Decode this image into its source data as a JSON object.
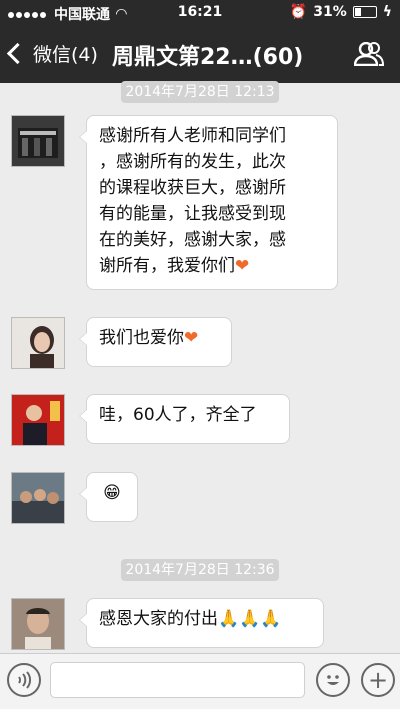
{
  "status_bar": {
    "carrier": "中国联通",
    "time": "16:21",
    "battery": "31%",
    "battery_level": 0.31
  },
  "nav": {
    "back_label": "微信(4)",
    "title": "周鼎文第22…(60)"
  },
  "timestamps": [
    "2014年7月28日 12:13",
    "2014年7月28日 12:36"
  ],
  "messages": [
    {
      "lines": [
        "感谢所有人老师和同学们",
        "，感谢所有的发生，此次",
        "的课程收获巨大，感谢所",
        "有的能量，让我感受到现",
        "在的美好，感谢大家，感",
        "谢所有，我爱你们"
      ],
      "trailing_emoji": "❤",
      "avatar_icon": "avatar-building-photo"
    },
    {
      "text": "我们也爱你",
      "trailing_emoji": "❤",
      "avatar_icon": "avatar-woman-photo"
    },
    {
      "text": "哇，60人了，齐全了",
      "avatar_icon": "avatar-man-red-background-photo"
    },
    {
      "text": "😁",
      "avatar_icon": "avatar-group-photo"
    },
    {
      "text": "感恩大家的付出",
      "trailing_emoji": "🙏🙏🙏",
      "avatar_icon": "avatar-man-portrait-photo"
    }
  ],
  "input_bar": {
    "voice_icon": "voice-icon",
    "emoji_icon": "emoji-icon",
    "add_icon": "plus-icon"
  }
}
